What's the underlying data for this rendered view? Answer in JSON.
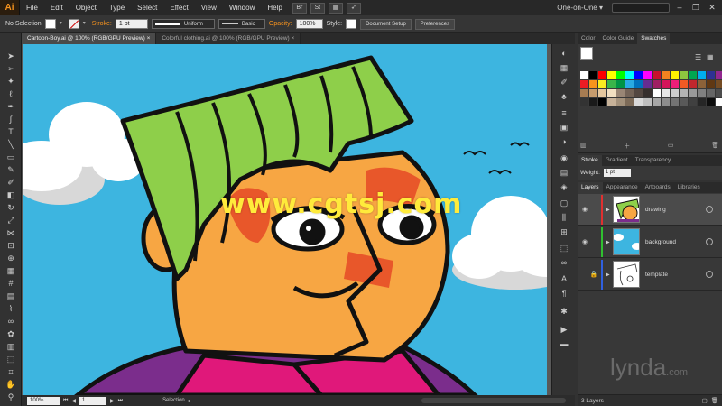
{
  "app": {
    "logo": "Ai",
    "workspace": "One-on-One ▾",
    "menu": [
      "File",
      "Edit",
      "Object",
      "Type",
      "Select",
      "Effect",
      "View",
      "Window",
      "Help"
    ],
    "mb_buttons": [
      "Br",
      "St"
    ]
  },
  "control": {
    "selection_label": "No Selection",
    "stroke_label": "Stroke:",
    "stroke_weight": "1 pt",
    "profile": "Uniform",
    "brush": "Basic",
    "opacity_label": "Opacity:",
    "opacity": "100%",
    "style_label": "Style:",
    "doc_setup": "Document Setup",
    "preferences": "Preferences"
  },
  "tabs": [
    {
      "label": "Cartoon-Boy.ai @ 100% (RGB/GPU Preview)",
      "close": "×"
    },
    {
      "label": "Colorful clothing.ai @ 100% (RGB/GPU Preview)",
      "close": "×"
    }
  ],
  "status": {
    "zoom": "100%",
    "artboard": "1",
    "tool": "Selection"
  },
  "panels": {
    "color_tabs": [
      "Color",
      "Color Guide",
      "Swatches"
    ],
    "stroke_tabs": [
      "Stroke",
      "Gradient",
      "Transparency"
    ],
    "weight_label": "Weight:",
    "weight_value": "1 pt",
    "layer_tabs": [
      "Layers",
      "Appearance",
      "Artboards",
      "Libraries"
    ],
    "layers": [
      {
        "name": "drawing",
        "color": "#e03030"
      },
      {
        "name": "background",
        "color": "#30c030"
      },
      {
        "name": "template",
        "color": "#3060e0"
      }
    ],
    "layer_count": "3 Layers"
  },
  "swatches": [
    "#ffffff",
    "#000000",
    "#ff0000",
    "#ffff00",
    "#00ff00",
    "#00ffff",
    "#0000ff",
    "#ff00ff",
    "#c8102e",
    "#f58220",
    "#fff200",
    "#8dc63f",
    "#00a651",
    "#00aeef",
    "#2e3192",
    "#92278f",
    "#ed1c24",
    "#f7941d",
    "#fbed21",
    "#39b54a",
    "#009444",
    "#29abe2",
    "#0072bc",
    "#662d91",
    "#9e1f63",
    "#d4145a",
    "#ed1e79",
    "#f15a24",
    "#c1272d",
    "#8c6239",
    "#603813",
    "#754c24",
    "#a67c52",
    "#c69c6d",
    "#e6c89e",
    "#f2e0c2",
    "#998675",
    "#736357",
    "#534741",
    "#362f2d",
    "#ffffff",
    "#e6e6e6",
    "#cccccc",
    "#b3b3b3",
    "#999999",
    "#808080",
    "#666666",
    "#4d4d4d",
    "#333333",
    "#1a1a1a",
    "#000000",
    "#c7b299",
    "#a3917b",
    "#7d6b58",
    "#d9d9d9",
    "#bfbfbf",
    "#a6a6a6",
    "#8c8c8c",
    "#737373",
    "#595959",
    "#404040",
    "#262626",
    "#0d0d0d",
    "#ffffff"
  ],
  "watermark": {
    "text": "www.cgtsj.com",
    "logo": "lynda",
    "logo_suffix": ".com"
  }
}
